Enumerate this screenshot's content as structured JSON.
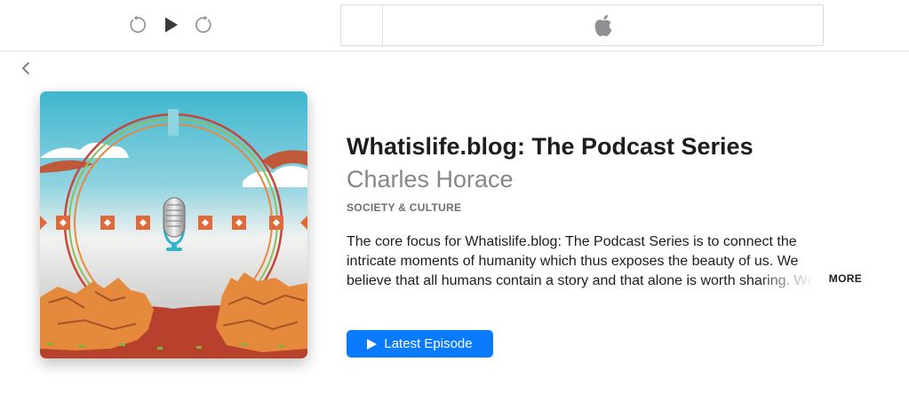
{
  "toolbar": {
    "controls": [
      {
        "name": "skip-back",
        "icon": "rewind-icon"
      },
      {
        "name": "play",
        "icon": "play-icon"
      },
      {
        "name": "skip-forward",
        "icon": "forward-icon"
      }
    ],
    "lcd_logo": "apple-logo-icon"
  },
  "nav": {
    "back_icon": "chevron-left-icon"
  },
  "podcast": {
    "title": "Whatislife.blog: The Podcast Series",
    "author": "Charles Horace",
    "category": "SOCIETY & CULTURE",
    "description": "The core focus for Whatislife.blog: The Podcast Series is to connect the intricate moments of humanity which thus exposes the beauty of us. We believe that all humans contain a story and that alone is worth sharing. We",
    "more_label": "MORE",
    "latest_episode_label": "Latest Episode"
  },
  "colors": {
    "accent": "#0a7bff",
    "secondary_text": "#86868b",
    "sky_top": "#3fb7cf",
    "rock": "#e58a3c",
    "ring_red": "#c6473a",
    "ring_green": "#8dbf5a"
  }
}
